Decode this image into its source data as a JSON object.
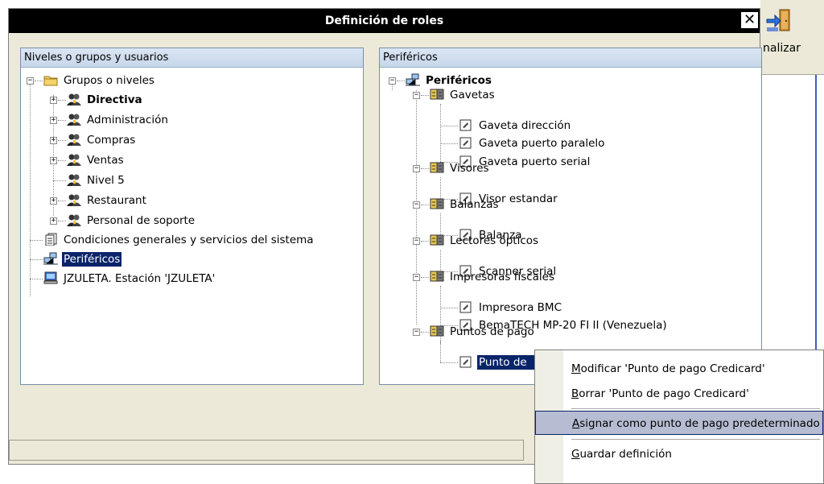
{
  "background_app": {
    "toolbar_label": "nalizar"
  },
  "dialog": {
    "title": "Definición de roles",
    "close_symbol": "✕"
  },
  "left_panel": {
    "header": "Niveles o grupos y usuarios",
    "tree": [
      {
        "label": "Grupos o niveles",
        "icon": "folder-icon"
      },
      {
        "label": "Directiva",
        "icon": "users-group-icon"
      },
      {
        "label": "Administración",
        "icon": "users-group-icon"
      },
      {
        "label": "Compras",
        "icon": "users-group-icon"
      },
      {
        "label": "Ventas",
        "icon": "users-group-icon"
      },
      {
        "label": "Nivel 5",
        "icon": "users-group-icon"
      },
      {
        "label": "Restaurant",
        "icon": "users-group-icon"
      },
      {
        "label": "Personal de soporte",
        "icon": "users-group-icon"
      },
      {
        "label": "Condiciones generales y servicios del sistema",
        "icon": "document-icon"
      },
      {
        "label": "Periféricos",
        "icon": "network-icon"
      },
      {
        "label": "JZULETA. Estación 'JZULETA'",
        "icon": "computer-icon"
      }
    ]
  },
  "right_panel": {
    "header": "Periféricos",
    "tree": [
      {
        "label": "Periféricos",
        "icon": "network-icon"
      },
      {
        "label": "Gavetas",
        "icon": "device-group-icon"
      },
      {
        "label": "Gaveta dirección",
        "icon": "device-icon"
      },
      {
        "label": "Gaveta puerto paralelo",
        "icon": "device-icon"
      },
      {
        "label": "Gaveta puerto serial",
        "icon": "device-icon"
      },
      {
        "label": "Visores",
        "icon": "device-group-icon"
      },
      {
        "label": "Visor estandar",
        "icon": "device-icon"
      },
      {
        "label": "Balanzas",
        "icon": "device-group-icon"
      },
      {
        "label": "Balanza",
        "icon": "device-icon"
      },
      {
        "label": "Lectores ópticos",
        "icon": "device-group-icon"
      },
      {
        "label": "Scanner serial",
        "icon": "device-icon"
      },
      {
        "label": "Impresoras fiscales",
        "icon": "device-group-icon"
      },
      {
        "label": "Impresora BMC",
        "icon": "device-icon"
      },
      {
        "label": "BemaTECH MP-20 FI II (Venezuela)",
        "icon": "device-icon"
      },
      {
        "label": "Puntos de pago",
        "icon": "device-group-icon"
      },
      {
        "label": "Punto de",
        "icon": "device-icon"
      }
    ]
  },
  "context_menu": {
    "items": [
      {
        "mnemonic": "M",
        "rest": "odificar 'Punto de pago Credicard'"
      },
      {
        "mnemonic": "B",
        "rest": "orrar 'Punto de pago Credicard'"
      },
      {
        "mnemonic": "A",
        "rest": "signar como punto de pago predeterminado"
      },
      {
        "mnemonic": "G",
        "rest": "uardar definición"
      }
    ]
  },
  "colors": {
    "selection": "#0a246a",
    "menu_highlight": "#b6bdd2",
    "title_bar": "#000000"
  }
}
